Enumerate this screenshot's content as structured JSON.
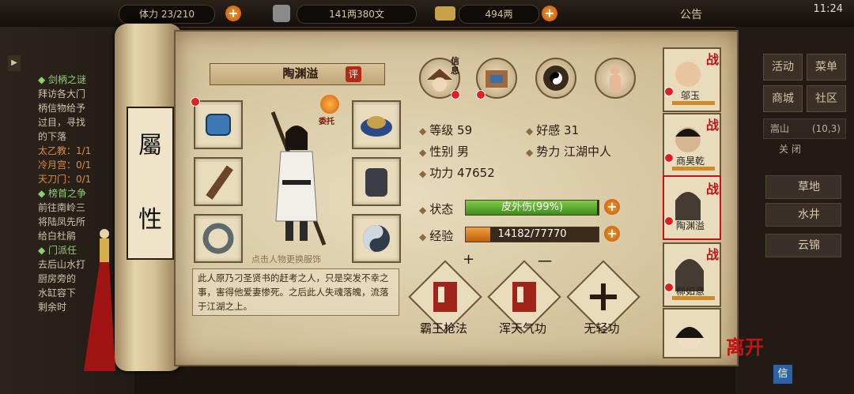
{
  "topbar": {
    "res1": "23/210",
    "res1_prefix": "体力",
    "coins": "141两380文",
    "silver": "494两",
    "notice": "公告",
    "time": "11:24"
  },
  "left_panel": {
    "lines": [
      "◆ 剑柄之谜",
      "拜访各大门",
      "柄信物给予",
      "过目，寻找",
      "的下落",
      "太乙教：1/1",
      "冷月宫：0/1",
      "天刀门：0/1",
      "◆ 榜首之争",
      "前往南岭三",
      "将陆凤先所",
      "给白杜鹃",
      "◆ 门派任",
      "去后山水打",
      "厨房旁的",
      "水缸容下",
      "剩余时"
    ]
  },
  "scroll": {
    "label_line1": "屬",
    "label_line2": "性"
  },
  "character": {
    "name": "陶渊溢",
    "review_btn": "评",
    "entrust": "委托",
    "change_hint": "点击人物更换服饰",
    "description": "此人原乃刁圣贤书的赶考之人，只是突发不幸之事，害得他爱妻惨死。之后此人失魂落魄，流落于江湖之上。"
  },
  "tabs": {
    "info_label": "信息"
  },
  "stats": {
    "level_label": "等级",
    "level": "59",
    "favor_label": "好感",
    "favor": "31",
    "gender_label": "性别",
    "gender": "男",
    "faction_label": "势力",
    "faction": "江湖中人",
    "power_label": "功力",
    "power": "47652",
    "state_label": "状态",
    "state": "皮外伤(99%)",
    "state_fill": 0.99,
    "exp_label": "经验",
    "exp": "14182/77770",
    "exp_fill": 0.182
  },
  "skills": [
    {
      "name": "霸王枪法"
    },
    {
      "name": "浑天气功"
    },
    {
      "name": "无轻功"
    }
  ],
  "skill_marks": {
    "plus": "+",
    "minus": "一"
  },
  "roster": [
    {
      "name": "邬玉",
      "tag": "战"
    },
    {
      "name": "商昊乾",
      "tag": "战"
    },
    {
      "name": "陶渊溢",
      "tag": "战"
    },
    {
      "name": "柳如意",
      "tag": "战"
    }
  ],
  "leave": "离开",
  "right_panel": {
    "btns": [
      "活动",
      "菜单",
      "商城",
      "社区"
    ],
    "location": "嵩山",
    "coords": "(10,3)",
    "places": [
      "草地",
      "水井",
      "云锦"
    ],
    "closed": "关 闭",
    "bottom": "信"
  }
}
